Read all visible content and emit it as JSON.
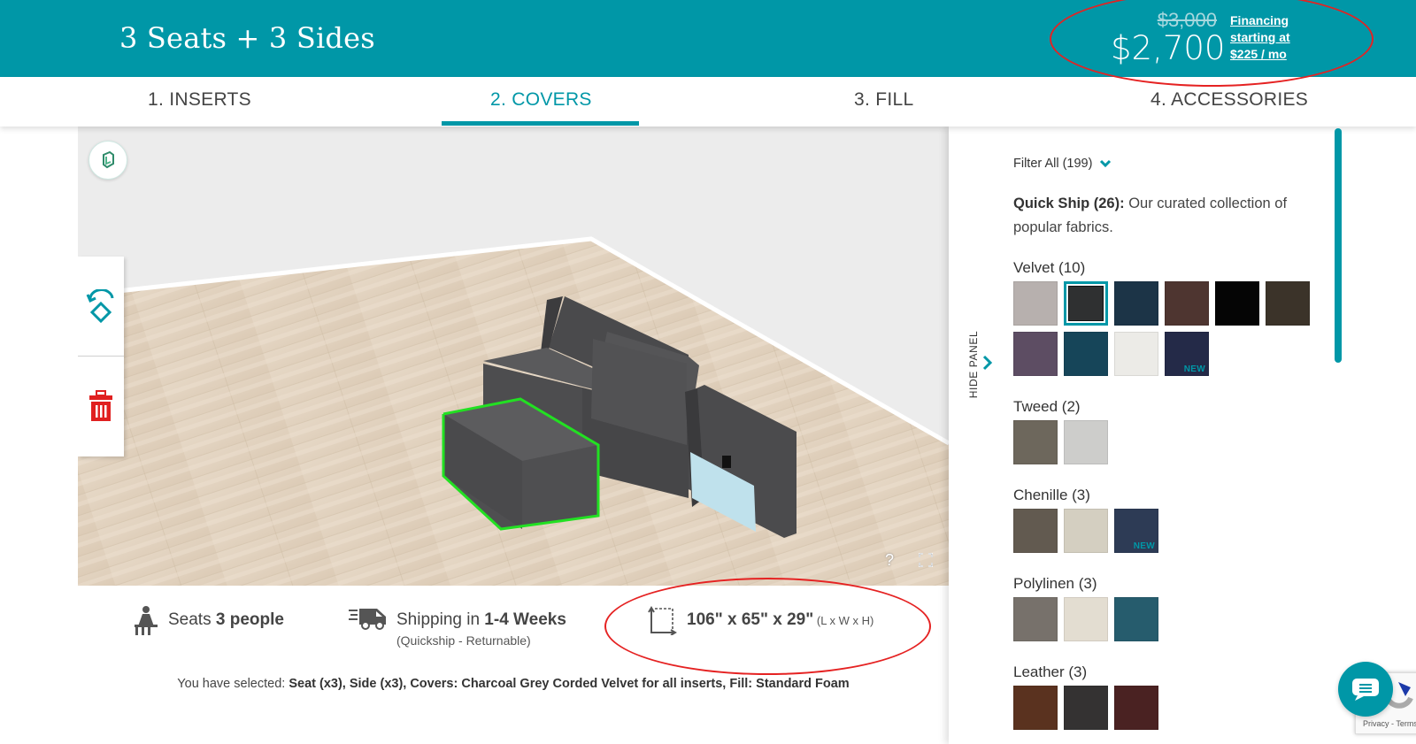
{
  "header": {
    "title": "3 Seats + 3 Sides",
    "price_original": "$3,000",
    "price_current": "$2,700",
    "financing_line1": "Financing",
    "financing_line2": "starting at",
    "financing_line3": "$225 / mo"
  },
  "tabs": [
    {
      "label": "1. INSERTS",
      "active": false
    },
    {
      "label": "2. COVERS",
      "active": true
    },
    {
      "label": "3. FILL",
      "active": false
    },
    {
      "label": "4. ACCESSORIES",
      "active": false
    }
  ],
  "viewer": {
    "ar_icon": "ar-cube-icon",
    "rotate_icon": "rotate-icon",
    "delete_icon": "trash-icon",
    "help_label": "?",
    "fullscreen_icon": "fullscreen-icon"
  },
  "info": {
    "seats_prefix": "Seats ",
    "seats_value": "3 people",
    "shipping_prefix": "Shipping in ",
    "shipping_value": "1-4 Weeks",
    "shipping_note": "(Quickship - Returnable)",
    "dimensions_value": "106\" x 65\" x 29\"",
    "dimensions_note": " (L x W x H)",
    "selected_prefix": "You have selected: ",
    "selected_value": "Seat (x3), Side (x3), Covers: Charcoal Grey Corded Velvet for all inserts, Fill: Standard Foam"
  },
  "panel": {
    "hide_label": "HIDE PANEL",
    "filter_label": "Filter All (199)",
    "quickship_title": "Quick Ship (26):",
    "quickship_desc": " Our curated collection of popular fabrics.",
    "groups": [
      {
        "title": "Velvet (10)",
        "swatches": [
          {
            "color": "#b7b0ae",
            "selected": false,
            "new": false
          },
          {
            "color": "#2f3031",
            "selected": true,
            "new": false
          },
          {
            "color": "#1c3447",
            "selected": false,
            "new": false
          },
          {
            "color": "#4e3530",
            "selected": false,
            "new": false
          },
          {
            "color": "#050505",
            "selected": false,
            "new": false
          },
          {
            "color": "#3b3329",
            "selected": false,
            "new": false
          },
          {
            "color": "#5d4d63",
            "selected": false,
            "new": false
          },
          {
            "color": "#164559",
            "selected": false,
            "new": false
          },
          {
            "color": "#ecebe7",
            "selected": false,
            "new": false
          },
          {
            "color": "#242a48",
            "selected": false,
            "new": true
          }
        ]
      },
      {
        "title": "Tweed (2)",
        "swatches": [
          {
            "color": "#6d675c",
            "selected": false,
            "new": false
          },
          {
            "color": "#cdcdcb",
            "selected": false,
            "new": false
          }
        ]
      },
      {
        "title": "Chenille (3)",
        "swatches": [
          {
            "color": "#625a50",
            "selected": false,
            "new": false
          },
          {
            "color": "#d4cfc1",
            "selected": false,
            "new": false
          },
          {
            "color": "#2d3b55",
            "selected": false,
            "new": true
          }
        ]
      },
      {
        "title": "Polylinen (3)",
        "swatches": [
          {
            "color": "#77716b",
            "selected": false,
            "new": false
          },
          {
            "color": "#e3ddd1",
            "selected": false,
            "new": false
          },
          {
            "color": "#265c6d",
            "selected": false,
            "new": false
          }
        ]
      },
      {
        "title": "Leather (3)",
        "swatches": [
          {
            "color": "#5a321f",
            "selected": false,
            "new": false
          },
          {
            "color": "#343232",
            "selected": false,
            "new": false
          },
          {
            "color": "#4a2222",
            "selected": false,
            "new": false
          }
        ]
      }
    ],
    "new_badge": "NEW"
  },
  "chat": {
    "icon": "chat-bubble-icon"
  },
  "recaptcha": {
    "links": "Privacy - Terms"
  },
  "colors": {
    "accent": "#0097a7",
    "annotation": "#e52222",
    "delete": "#e02020",
    "highlight": "#22e022"
  }
}
